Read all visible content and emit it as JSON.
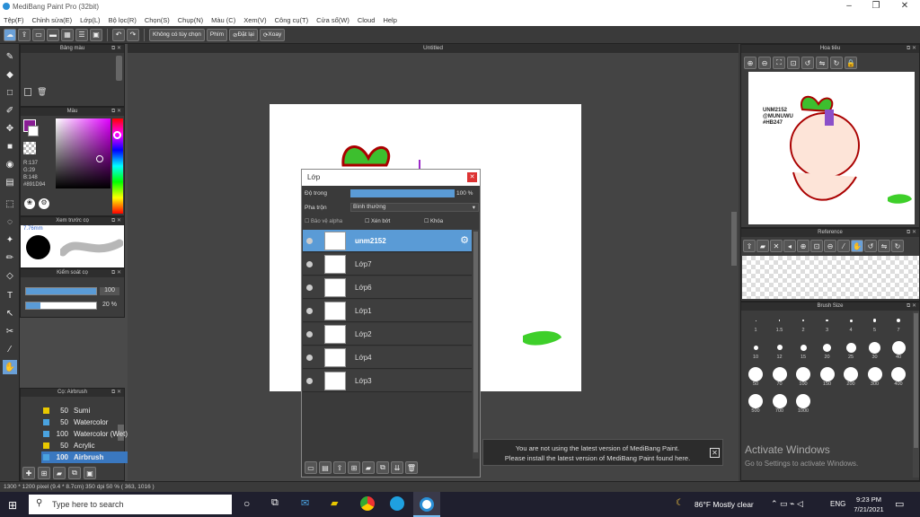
{
  "titlebar": {
    "title": "MediBang Paint Pro (32bit)"
  },
  "menu": [
    "Tệp(F)",
    "Chỉnh sửa(E)",
    "Lớp(L)",
    "Bộ lọc(R)",
    "Chọn(S)",
    "Chụp(N)",
    "Màu (C)",
    "Xem(V)",
    "Công cụ(T)",
    "Cửa sổ(W)",
    "Cloud",
    "Help"
  ],
  "toolbar": {
    "select_mode": "Không có tùy chọn",
    "key_label": "Phím",
    "reset_label": "Đặt lại",
    "rotate_label": "Xoay"
  },
  "panels": {
    "brush_color": "Bảng màu",
    "color": "Màu",
    "brush_preview": "Xem trước cọ",
    "brush_control": "Kiểm soát cọ",
    "brush_list": "Cọ: Airbrush",
    "canvas_title": "Untitled",
    "navigator": "Hoa tiêu",
    "reference": "Reference",
    "brush_size": "Brush Size"
  },
  "color": {
    "r": "R:137",
    "g": "G:29",
    "b": "B:148",
    "hex": "#891D94",
    "main": "#891D94"
  },
  "brush_preview": {
    "size": "7.76mm"
  },
  "brush_control": {
    "size": "100",
    "opacity": "20 %"
  },
  "brushes": [
    {
      "num": "50",
      "name": "Sumi",
      "color": "#e8c800"
    },
    {
      "num": "50",
      "name": "Watercolor",
      "color": "#4aa3e0"
    },
    {
      "num": "100",
      "name": "Watercolor (Wet)",
      "color": "#4aa3e0"
    },
    {
      "num": "50",
      "name": "Acrylic",
      "color": "#e8c800"
    },
    {
      "num": "100",
      "name": "Airbrush",
      "color": "#4aa3e0"
    }
  ],
  "layer_window": {
    "title": "Lớp",
    "opacity_label": "Độ trong",
    "opacity_value": "100 %",
    "blend_label": "Pha trộn",
    "blend_value": "Bình thường",
    "protect_alpha": "Bảo vệ alpha",
    "clipping": "Xén bớt",
    "lock": "Khóa",
    "layers": [
      {
        "name": "unm2152",
        "selected": true
      },
      {
        "name": "Lớp7"
      },
      {
        "name": "Lớp6"
      },
      {
        "name": "Lớp1"
      },
      {
        "name": "Lớp2"
      },
      {
        "name": "Lớp4"
      },
      {
        "name": "Lớp3"
      }
    ]
  },
  "navigator_text": [
    "UNM2152",
    "@MUNUWU",
    "#HB247"
  ],
  "brush_sizes": [
    {
      "l": "1",
      "d": 1
    },
    {
      "l": "1.5",
      "d": 1.5
    },
    {
      "l": "2",
      "d": 2
    },
    {
      "l": "3",
      "d": 2.5
    },
    {
      "l": "4",
      "d": 3
    },
    {
      "l": "5",
      "d": 3.5
    },
    {
      "l": "7",
      "d": 4
    },
    {
      "l": "10",
      "d": 5
    },
    {
      "l": "12",
      "d": 6
    },
    {
      "l": "15",
      "d": 7
    },
    {
      "l": "20",
      "d": 9
    },
    {
      "l": "25",
      "d": 11
    },
    {
      "l": "30",
      "d": 13
    },
    {
      "l": "40",
      "d": 15
    },
    {
      "l": "50",
      "d": 16
    },
    {
      "l": "70",
      "d": 16
    },
    {
      "l": "100",
      "d": 16
    },
    {
      "l": "150",
      "d": 16
    },
    {
      "l": "200",
      "d": 16
    },
    {
      "l": "300",
      "d": 16
    },
    {
      "l": "400",
      "d": 16
    },
    {
      "l": "500",
      "d": 16
    },
    {
      "l": "700",
      "d": 16
    },
    {
      "l": "1000",
      "d": 16
    }
  ],
  "notification": "You are not using the latest version of MediBang Paint.\nPlease install the latest version of MediBang Paint found here.",
  "watermark": {
    "title": "Activate Windows",
    "sub": "Go to Settings to activate Windows."
  },
  "status": "1300 * 1200 pixel   (9.4 * 8.7cm)   350 dpi   50 %   ( 363, 1016 )",
  "taskbar": {
    "search": "Type here to search",
    "weather": "86°F  Mostly clear",
    "lang": "ENG",
    "time": "9:23 PM",
    "date": "7/21/2021"
  }
}
